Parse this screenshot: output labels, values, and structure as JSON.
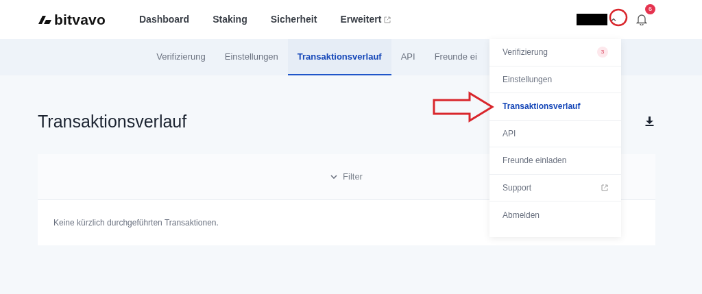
{
  "brand": {
    "name": "bitvavo"
  },
  "nav": [
    {
      "label": "Dashboard",
      "external": false
    },
    {
      "label": "Staking",
      "external": false
    },
    {
      "label": "Sicherheit",
      "external": false
    },
    {
      "label": "Erweitert",
      "external": true
    }
  ],
  "account": {
    "expanded": true
  },
  "notifications": {
    "count": "6"
  },
  "subnav": [
    {
      "label": "Verifizierung",
      "selected": false
    },
    {
      "label": "Einstellungen",
      "selected": false
    },
    {
      "label": "Transaktionsverlauf",
      "selected": true
    },
    {
      "label": "API",
      "selected": false
    },
    {
      "label": "Freunde ei",
      "selected": false
    }
  ],
  "page_title": "Transaktionsverlauf",
  "filter": {
    "label": "Filter",
    "expanded": false
  },
  "empty_message": "Keine kürzlich durchgeführten Transaktionen.",
  "menu": [
    {
      "label": "Verifizierung",
      "selected": false,
      "badge": "3",
      "external": false
    },
    {
      "label": "Einstellungen",
      "selected": false,
      "external": false
    },
    {
      "label": "Transaktionsverlauf",
      "selected": true,
      "external": false
    },
    {
      "label": "API",
      "selected": false,
      "external": false
    },
    {
      "label": "Freunde einladen",
      "selected": false,
      "external": false
    },
    {
      "label": "Support",
      "selected": false,
      "external": true
    },
    {
      "label": "Abmelden",
      "selected": false,
      "external": false
    }
  ]
}
